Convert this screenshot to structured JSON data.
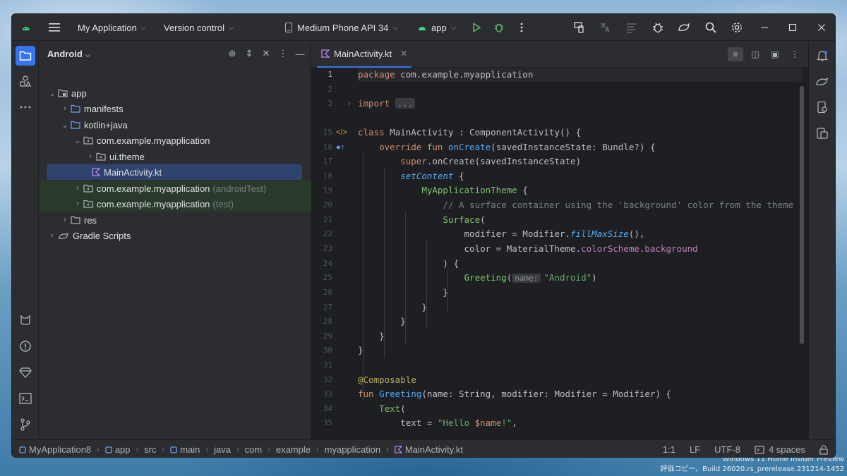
{
  "titlebar": {
    "project_name": "My Application",
    "vcs": "Version control",
    "device": "Medium Phone API 34",
    "run_config": "app"
  },
  "project_panel": {
    "view_name": "Android",
    "tree": {
      "app": "app",
      "manifests": "manifests",
      "kotlin_java": "kotlin+java",
      "pkg_main": "com.example.myapplication",
      "ui_theme": "ui.theme",
      "main_activity": "MainActivity.kt",
      "pkg_android_test": "com.example.myapplication",
      "pkg_android_test_suffix": "(androidTest)",
      "pkg_test": "com.example.myapplication",
      "pkg_test_suffix": "(test)",
      "res": "res",
      "gradle_scripts": "Gradle Scripts"
    }
  },
  "editor": {
    "tab_label": "MainActivity.kt",
    "line_numbers": [
      "1",
      "2",
      "3",
      "15",
      "16",
      "17",
      "18",
      "19",
      "20",
      "21",
      "22",
      "23",
      "24",
      "25",
      "26",
      "27",
      "28",
      "29",
      "30",
      "31",
      "32",
      "33",
      "34",
      "35"
    ],
    "code": {
      "l1_kw": "package",
      "l1_rest": " com.example.myapplication",
      "l3_kw": "import",
      "l3_fold": "...",
      "l15_kw": "class",
      "l15_rest": " MainActivity : ComponentActivity() {",
      "l16_kw": "override fun",
      "l16_fn": "onCreate",
      "l16_rest": "(savedInstanceState: Bundle?) {",
      "l17_kw": "super",
      "l17_rest": ".onCreate(savedInstanceState)",
      "l18_fn": "setContent",
      "l18_rest": " {",
      "l19_cmp": "MyApplicationTheme",
      "l19_rest": " {",
      "l20_cmt": "// A surface container using the 'background' color from the theme",
      "l21_cmp": "Surface",
      "l21_rest": "(",
      "l22_a": "modifier = Modifier.",
      "l22_fn": "fillMaxSize",
      "l22_b": "(),",
      "l23_a": "color = MaterialTheme.",
      "l23_p1": "colorScheme",
      "l23_dot": ".",
      "l23_p2": "background",
      "l24": ") {",
      "l25_cmp": "Greeting",
      "l25_paren": "(",
      "l25_hint": "name:",
      "l25_str": "\"Android\"",
      "l25_close": ")",
      "l26": "}",
      "l27": "}",
      "l28": "}",
      "l29": "}",
      "l30": "}",
      "l32_ann": "@Composable",
      "l33_kw": "fun",
      "l33_fn": "Greeting",
      "l33_rest": "(name: String, modifier: Modifier = Modifier) {",
      "l34_cmp": "Text",
      "l34_rest": "(",
      "l35_a": "text = ",
      "l35_str": "\"Hello ",
      "l35_var": "$name",
      "l35_str2": "!\"",
      "l35_b": ","
    }
  },
  "statusbar": {
    "breadcrumbs": [
      "MyApplication8",
      "app",
      "src",
      "main",
      "java",
      "com",
      "example",
      "myapplication",
      "MainActivity.kt"
    ],
    "position": "1:1",
    "line_sep": "LF",
    "encoding": "UTF-8",
    "indent": "4 spaces"
  },
  "desktop": {
    "watermark_line1": "Windows 11 Home Insider Preview",
    "watermark_line2": "評価コピー。Build 26020.rs_prerelease.231214-1452"
  },
  "colors": {
    "accent": "#3574f0",
    "background": "#1e1f22",
    "panel": "#2b2d30",
    "keyword": "#cf8e6d",
    "function": "#56a8f5",
    "string": "#6aab73"
  }
}
